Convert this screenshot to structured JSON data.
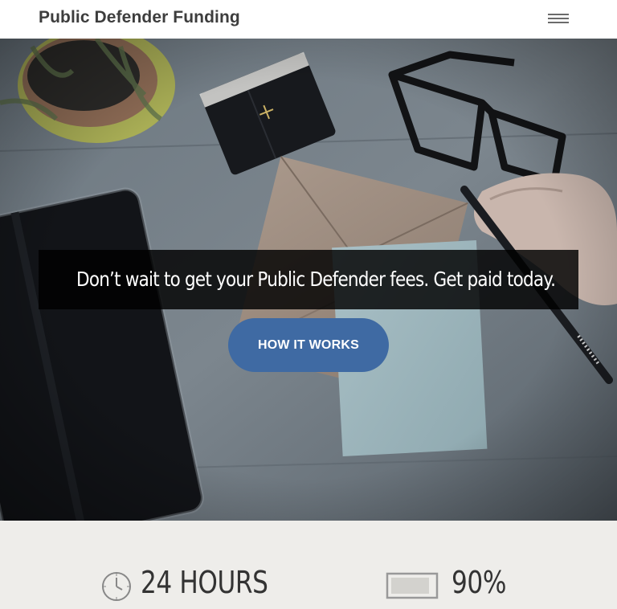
{
  "header": {
    "brand": "Public Defender Funding",
    "menu_icon": "hamburger-menu-icon"
  },
  "hero": {
    "tagline": "Don’t wait to get your Public Defender fees. Get paid today.",
    "cta_label": "HOW IT WORKS",
    "background": "desk-photo-notebook-glasses-envelopes-pencil"
  },
  "stats": [
    {
      "icon": "clock-icon",
      "value": "24 HOURS"
    },
    {
      "icon": "battery-icon",
      "value": "90%",
      "battery_level_percent": 90
    }
  ],
  "colors": {
    "cta": "#3f6aa3",
    "tagline_bg": "#000000",
    "stats_bg": "#eeedea",
    "brand_text": "#3d3d3d"
  }
}
